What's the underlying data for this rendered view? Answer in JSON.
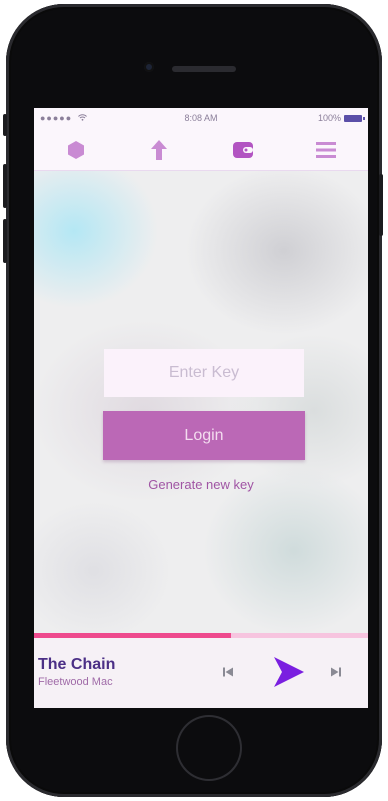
{
  "status_bar": {
    "signal": "●●●●● ",
    "time": "8:08 AM",
    "battery": "100%"
  },
  "nav": {
    "icons": [
      "hexagon-icon",
      "upload-arrow-icon",
      "wallet-icon",
      "hamburger-menu-icon"
    ]
  },
  "login": {
    "key_placeholder": "Enter Key",
    "login_label": "Login",
    "generate_label": "Generate new key"
  },
  "player": {
    "track": "The Chain",
    "artist": "Fleetwood Mac",
    "progress": 0.59
  },
  "colors": {
    "accent": "#bb68b6",
    "nav_icon": "#c98bd3",
    "play": "#7a1fe0",
    "progress_fill": "#ee4a8d",
    "progress_track": "#f7c4df",
    "track_title": "#4b2f86"
  }
}
